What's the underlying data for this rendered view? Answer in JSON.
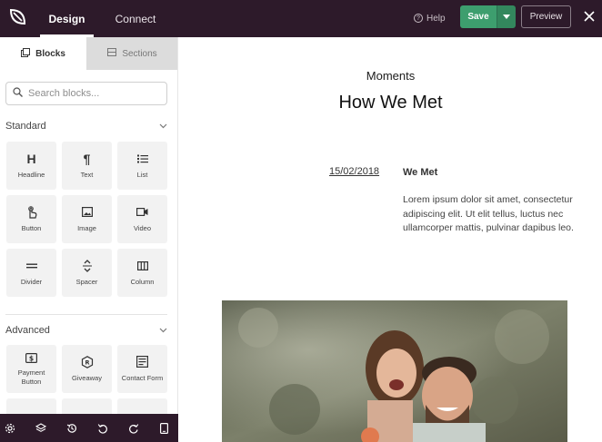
{
  "topbar": {
    "tabs": [
      {
        "label": "Design",
        "active": true
      },
      {
        "label": "Connect",
        "active": false
      }
    ],
    "help_label": "Help",
    "save_label": "Save",
    "preview_label": "Preview",
    "background_color": "#2d1a2a",
    "save_color": "#3d9e6e"
  },
  "sidebar": {
    "tabs": [
      {
        "label": "Blocks",
        "active": true,
        "icon": "blocks-icon"
      },
      {
        "label": "Sections",
        "active": false,
        "icon": "sections-icon"
      }
    ],
    "search_placeholder": "Search blocks...",
    "standard": {
      "title": "Standard",
      "blocks": [
        {
          "label": "Headline",
          "icon": "headline-icon"
        },
        {
          "label": "Text",
          "icon": "paragraph-icon"
        },
        {
          "label": "List",
          "icon": "list-icon"
        },
        {
          "label": "Button",
          "icon": "pointer-icon"
        },
        {
          "label": "Image",
          "icon": "image-icon"
        },
        {
          "label": "Video",
          "icon": "video-icon"
        },
        {
          "label": "Divider",
          "icon": "divider-icon"
        },
        {
          "label": "Spacer",
          "icon": "spacer-icon"
        },
        {
          "label": "Column",
          "icon": "column-icon"
        }
      ]
    },
    "advanced": {
      "title": "Advanced",
      "blocks": [
        {
          "label": "Payment Button",
          "icon": "dollar-icon"
        },
        {
          "label": "Giveaway",
          "icon": "giveaway-icon"
        },
        {
          "label": "Contact Form",
          "icon": "form-icon"
        }
      ]
    }
  },
  "canvas": {
    "eyebrow": "Moments",
    "heading": "How We Met",
    "entry": {
      "date": "15/02/2018",
      "title": "We Met",
      "body": "Lorem ipsum dolor sit amet, consectetur adipiscing elit. Ut elit tellus, luctus nec ullamcorper mattis, pulvinar dapibus leo."
    }
  }
}
